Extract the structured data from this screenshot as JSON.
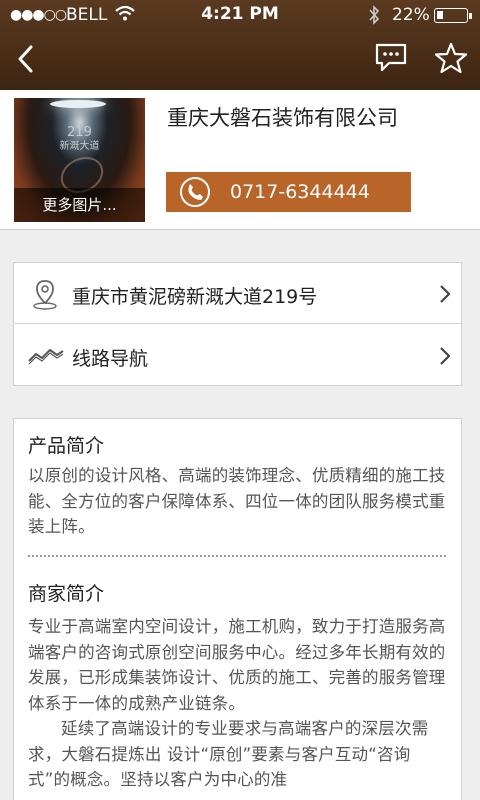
{
  "status_bar": {
    "carrier": "BELL",
    "time": "4:21 PM",
    "battery": "22%",
    "battery_level": 0.22
  },
  "nav": {
    "icons": [
      "back-chevron-icon",
      "chat-icon",
      "star-icon"
    ]
  },
  "company": {
    "name": "重庆大磐石装饰有限公司",
    "photo_caption": "更多图片...",
    "photo_sign": [
      "219",
      "新溉大道"
    ],
    "phone": "0717-6344444"
  },
  "address": {
    "text": "重庆市黄泥磅新溉大道219号",
    "route_label": "线路导航"
  },
  "product_intro": {
    "title": "产品简介",
    "text": "以原创的设计风格、高端的装饰理念、优质精细的施工技能、全方位的客户保障体系、四位一体的团队服务模式重装上阵。"
  },
  "merchant_intro": {
    "title": "商家简介",
    "text": "专业于高端室内空间设计，施工机购，致力于打造服务高端客户的咨询式原创空间服务中心。经过多年长期有效的发展，已形成集装饰设计、优质的施工、完善的服务管理体系于一体的成熟产业链条。",
    "text2": "延续了高端设计的专业要求与高端客户的深层次需求，大磐石提炼出 设计“原创”要素与客户互动“咨询式”的概念。坚持以客户为中心的准"
  },
  "colors": {
    "nav_bar": "#4a2e18",
    "accent": "#b9652a"
  }
}
